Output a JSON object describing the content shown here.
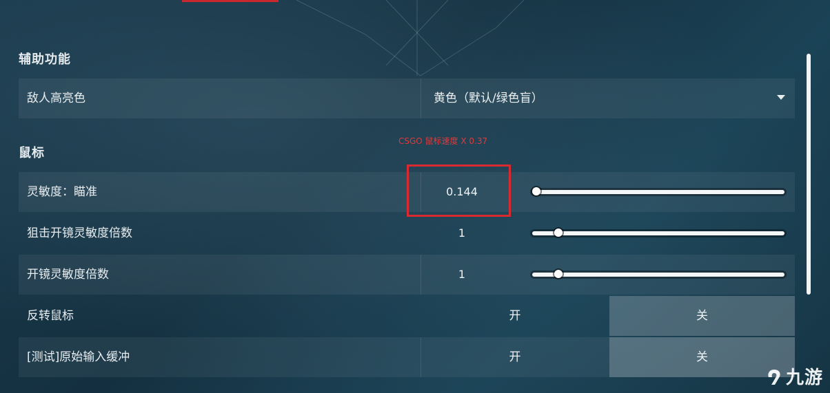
{
  "sections": {
    "accessibility": {
      "title": "辅助功能",
      "enemy_highlight": {
        "label": "敌人高亮色",
        "value": "黄色（默认/绿色盲）"
      }
    },
    "mouse": {
      "title": "鼠标",
      "annotation": "CSGO 鼠标速度 X 0.37",
      "rows": [
        {
          "label": "灵敏度：瞄准",
          "value": "0.144",
          "slider_fraction": 0.0
        },
        {
          "label": "狙击开镜灵敏度倍数",
          "value": "1",
          "slider_fraction": 0.09
        },
        {
          "label": "开镜灵敏度倍数",
          "value": "1",
          "slider_fraction": 0.09
        }
      ],
      "invert_mouse": {
        "label": "反转鼠标",
        "on": "开",
        "off": "关",
        "selected": "off"
      },
      "raw_input_buffer": {
        "label": "[测试]原始输入缓冲",
        "on": "开",
        "off": "关",
        "selected": "off"
      }
    }
  },
  "watermark": "九游",
  "colors": {
    "highlight": "#d82a2f",
    "selected_toggle": "#c8d2d7"
  },
  "icons": {
    "dropdown": "chevron-down-icon",
    "watermark_logo": "jiuyou-logo"
  }
}
